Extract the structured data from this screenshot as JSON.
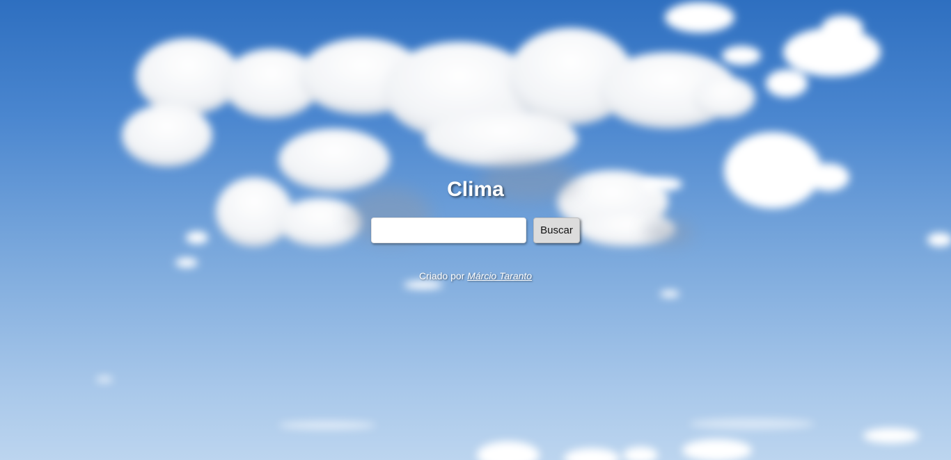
{
  "page": {
    "title": "Clima",
    "background": "sky-with-clouds"
  },
  "search": {
    "input_value": "",
    "placeholder": "",
    "button_label": "Buscar"
  },
  "footer": {
    "credit_prefix": "Criado por",
    "author_name": "Márcio Taranto"
  },
  "colors": {
    "sky_top": "#2e6fc0",
    "sky_bottom": "#bcd5ef",
    "button_bg": "#dcdcdc",
    "text": "#ffffff"
  }
}
